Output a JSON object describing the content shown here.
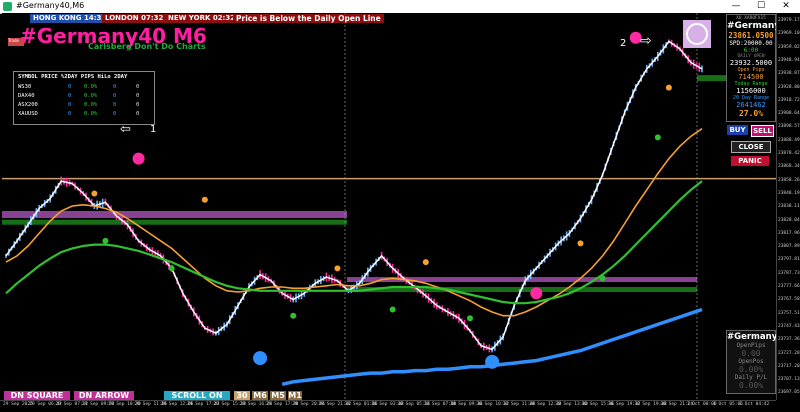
{
  "window": {
    "title": "#Germany40,M6",
    "minimize": "—",
    "maximize": "☐",
    "close": "✕"
  },
  "clocks": [
    {
      "label": "HONG KONG 14:32",
      "bg": "#1f4fa8"
    },
    {
      "label": "LONDON 07:32",
      "bg": "#8a1010"
    },
    {
      "label": "NEW YORK 02:32",
      "bg": "#8a1010"
    }
  ],
  "alert": "Price is Below the Daily Open Line",
  "header": {
    "title": "#Germany40 M6",
    "subtitle": "Carlsberg Don't Do Charts",
    "small_box": "Trade"
  },
  "symbol_table": {
    "header": "SYMBOL PRICE %2DAY PIPS HiLo 2DAY",
    "rows": [
      {
        "sym": "WS30",
        "price": "0",
        "pct": "0.0%",
        "pips": "0",
        "hilo": "0"
      },
      {
        "sym": "DAX40",
        "price": "0",
        "pct": "0.0%",
        "pips": "0",
        "hilo": "0"
      },
      {
        "sym": "ASX200",
        "price": "0",
        "pct": "0.0%",
        "pips": "0",
        "hilo": "0"
      },
      {
        "sym": "XAUUSD",
        "price": "0",
        "pct": "0.0%",
        "pips": "0",
        "hilo": "0"
      }
    ]
  },
  "side_panel": {
    "top_label": "XU XAROFX15",
    "symbol": "#Germany",
    "price": "23861.0500",
    "spd": "SPD:20000.00",
    "timer": "6:00",
    "daily_open_label": "DAILY OPEN",
    "daily_open": "23932.5000",
    "open_pips_label": "Open Pips",
    "open_pips": "714500",
    "today_range_label": "Today Range",
    "today_range": "1156000",
    "day20_label": "20 Day Range",
    "day20": "2641462",
    "pct": "27.0%"
  },
  "buttons": {
    "buy": "BUY",
    "sell": "SELL",
    "close": "CLOSE",
    "panic": "PANIC"
  },
  "bottom_panel": {
    "symbol": "#Germany",
    "open_pips_label": "OpenPips",
    "open_pips": "0.00",
    "open_pos_label": "OpenPos",
    "open_pos": "0.00%",
    "daily_pl_label": "Daily P/L",
    "daily_pl": "0.00%"
  },
  "bottom_buttons": {
    "dn_square": "DN SQUARE",
    "dn_arrow": "DN ARROW",
    "scroll_on": "SCROLL ON",
    "tf30": "30",
    "tf_m6": "M6",
    "tf_m5": "M5",
    "tf_m1": "M1"
  },
  "annotations": {
    "one": "1",
    "two": "2"
  },
  "colors": {
    "ema_fast": "#f7a030",
    "ema_slow": "#30c030",
    "price_line": "#ffffff",
    "long_ma": "#2f8fff",
    "marker_pink": "#ff2aa0",
    "marker_orange": "#f7a030",
    "marker_green": "#30c030",
    "zone_green": "#1a7a1a",
    "zone_violet": "#c060d0"
  },
  "chart_data": {
    "type": "line",
    "title": "#Germany40 M6",
    "xlabel": "",
    "ylabel": "",
    "y_ticks": [
      "23979.17",
      "23969.10",
      "23959.02",
      "23948.94",
      "23938.87",
      "23928.80",
      "23918.72",
      "23908.64",
      "23898.57",
      "23888.49",
      "23878.42",
      "23868.34",
      "23858.26",
      "23848.19",
      "23838.11",
      "23828.04",
      "23817.96",
      "23807.89",
      "23797.81",
      "23787.73",
      "23777.66",
      "23767.58",
      "23757.51",
      "23747.43",
      "23737.36",
      "23727.28",
      "23717.20",
      "23707.13",
      "23697.05"
    ],
    "x_ticks": [
      "29 Sep 2025",
      "29 Sep 06:42",
      "29 Sep 07:12",
      "29 Sep 09:54",
      "29 Sep 10:30",
      "29 Sep 11:06",
      "29 Sep 12:06",
      "29 Sep 17:42",
      "29 Sep 15:18",
      "29 Sep 16:24",
      "29 Sep 17:30",
      "29 Sep 20:06",
      "29 Sep 21:42",
      "30 Sep 01:06",
      "30 Sep 03:48",
      "30 Sep 05:24",
      "30 Sep 07:00",
      "30 Sep 09:36",
      "30 Sep 10:12",
      "30 Sep 11:48",
      "30 Sep 12:24",
      "30 Sep 13:00",
      "30 Sep 15:36",
      "30 Sep 19:12",
      "30 Sep 19:48",
      "30 Sep 21:24",
      "1 Oct 00:00",
      "1 Oct 05:06",
      "1 Oct 04:42"
    ],
    "series": [
      {
        "name": "price",
        "values": [
          23800,
          23812,
          23825,
          23838,
          23846,
          23860,
          23858,
          23850,
          23840,
          23843,
          23832,
          23825,
          23812,
          23805,
          23800,
          23790,
          23770,
          23755,
          23742,
          23738,
          23745,
          23760,
          23775,
          23785,
          23780,
          23770,
          23765,
          23770,
          23778,
          23783,
          23780,
          23772,
          23778,
          23790,
          23800,
          23790,
          23782,
          23775,
          23768,
          23760,
          23755,
          23750,
          23740,
          23728,
          23725,
          23735,
          23760,
          23780,
          23790,
          23800,
          23810,
          23818,
          23830,
          23845,
          23865,
          23890,
          23915,
          23935,
          23950,
          23960,
          23972,
          23966,
          23955,
          23950
        ]
      },
      {
        "name": "ema-fast",
        "values": [
          23795,
          23800,
          23808,
          23818,
          23828,
          23836,
          23840,
          23841,
          23840,
          23838,
          23835,
          23830,
          23824,
          23818,
          23812,
          23806,
          23798,
          23790,
          23782,
          23776,
          23772,
          23771,
          23772,
          23774,
          23775,
          23775,
          23774,
          23774,
          23775,
          23776,
          23777,
          23776,
          23776,
          23778,
          23781,
          23782,
          23781,
          23780,
          23778,
          23775,
          23772,
          23768,
          23764,
          23759,
          23755,
          23752,
          23752,
          23755,
          23759,
          23764,
          23769,
          23775,
          23782,
          23790,
          23800,
          23812,
          23826,
          23840,
          23853,
          23866,
          23878,
          23888,
          23896,
          23902
        ]
      },
      {
        "name": "ema-slow",
        "values": [
          23770,
          23778,
          23785,
          23792,
          23798,
          23803,
          23806,
          23808,
          23809,
          23809,
          23808,
          23806,
          23804,
          23801,
          23798,
          23795,
          23791,
          23787,
          23783,
          23779,
          23776,
          23774,
          23773,
          23772,
          23772,
          23772,
          23772,
          23772,
          23772,
          23772,
          23772,
          23772,
          23772,
          23773,
          23774,
          23775,
          23775,
          23775,
          23775,
          23774,
          23773,
          23771,
          23769,
          23767,
          23765,
          23763,
          23762,
          23762,
          23763,
          23765,
          23767,
          23770,
          23774,
          23779,
          23785,
          23792,
          23800,
          23809,
          23818,
          23827,
          23836,
          23845,
          23853,
          23860
        ]
      },
      {
        "name": "long-ma",
        "values": [
          null,
          null,
          null,
          null,
          null,
          null,
          null,
          null,
          null,
          null,
          null,
          null,
          null,
          null,
          null,
          null,
          null,
          null,
          null,
          null,
          null,
          null,
          null,
          null,
          null,
          23697,
          23699,
          23700,
          23701,
          23702,
          23703,
          23704,
          23705,
          23706,
          23706,
          23707,
          23707,
          23708,
          23708,
          23709,
          23709,
          23710,
          23711,
          23711,
          23712,
          23713,
          23714,
          23715,
          23716,
          23718,
          23720,
          23722,
          23724,
          23727,
          23730,
          23733,
          23736,
          23739,
          23742,
          23745,
          23748,
          23751,
          23754,
          23757
        ]
      }
    ],
    "ylim": [
      23690,
      23990
    ],
    "grid": false,
    "legend": "none"
  }
}
